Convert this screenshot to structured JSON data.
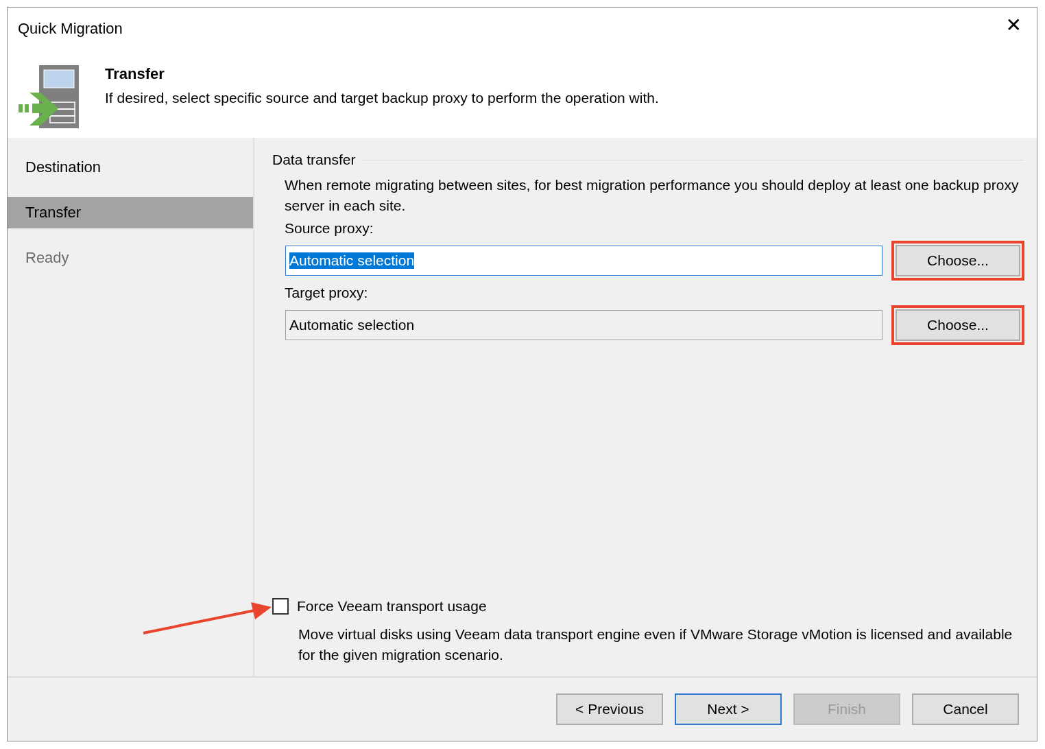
{
  "window": {
    "title": "Quick Migration",
    "close": "✕"
  },
  "header": {
    "title": "Transfer",
    "subtitle": "If desired, select specific source and target backup proxy to perform the operation with."
  },
  "steps": [
    {
      "label": "Destination",
      "selected": false,
      "disabled": false
    },
    {
      "label": "Transfer",
      "selected": true,
      "disabled": false
    },
    {
      "label": "Ready",
      "selected": false,
      "disabled": true
    }
  ],
  "group": {
    "title": "Data transfer",
    "description": "When remote migrating between sites, for best migration performance you should deploy at least one backup proxy server in each site."
  },
  "proxies": [
    {
      "label": "Source proxy:",
      "value": "Automatic selection",
      "focused": true,
      "text_selected": true,
      "button": "Choose...",
      "highlighted": true
    },
    {
      "label": "Target proxy:",
      "value": "Automatic selection",
      "focused": false,
      "text_selected": false,
      "button": "Choose...",
      "highlighted": true
    }
  ],
  "option": {
    "label": "Force Veeam transport usage",
    "checked": false,
    "annotated": true,
    "description": "Move virtual disks using Veeam data transport engine even if VMware Storage vMotion is licensed and available for the given migration scenario."
  },
  "buttons": [
    {
      "label": "< Previous",
      "default": false,
      "disabled": false
    },
    {
      "label": "Next >",
      "default": true,
      "disabled": false
    },
    {
      "label": "Finish",
      "default": false,
      "disabled": true
    },
    {
      "label": "Cancel",
      "default": false,
      "disabled": false
    }
  ]
}
